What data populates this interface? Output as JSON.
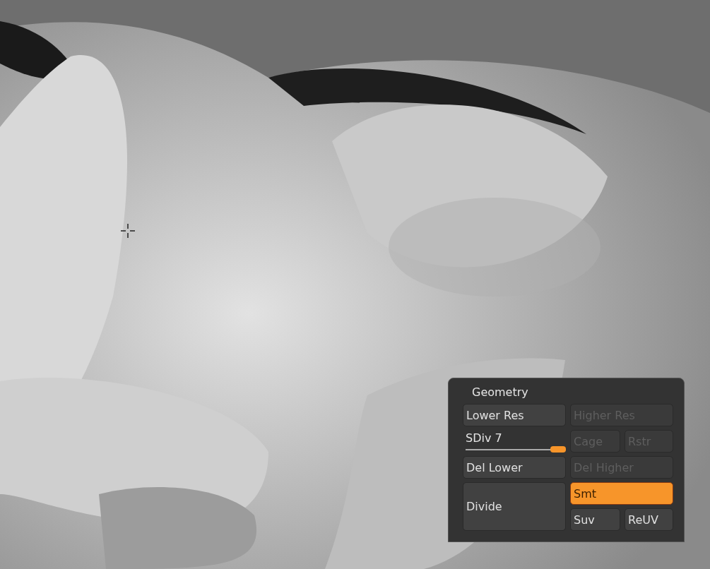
{
  "panel": {
    "title": "Geometry",
    "controls": [
      {
        "kind": "button",
        "label": "Lower Res",
        "disabled": false,
        "on": false
      },
      {
        "kind": "button",
        "label": "Higher Res",
        "disabled": true,
        "on": false
      },
      {
        "kind": "slider",
        "label": "SDiv 7",
        "level": 1
      },
      {
        "kind": "button",
        "label": "Cage",
        "disabled": true,
        "on": false
      },
      {
        "kind": "button",
        "label": "Rstr",
        "disabled": true,
        "on": false
      },
      {
        "kind": "button",
        "label": "Del Lower",
        "disabled": false,
        "on": false
      },
      {
        "kind": "button",
        "label": "Del Higher",
        "disabled": true,
        "on": false
      },
      {
        "kind": "button",
        "label": "Divide",
        "disabled": false,
        "on": false
      },
      {
        "kind": "button",
        "label": "Smt",
        "disabled": false,
        "on": true
      },
      {
        "kind": "button",
        "label": "Suv",
        "disabled": false,
        "on": false
      },
      {
        "kind": "button",
        "label": "ReUV",
        "disabled": false,
        "on": false
      }
    ]
  }
}
